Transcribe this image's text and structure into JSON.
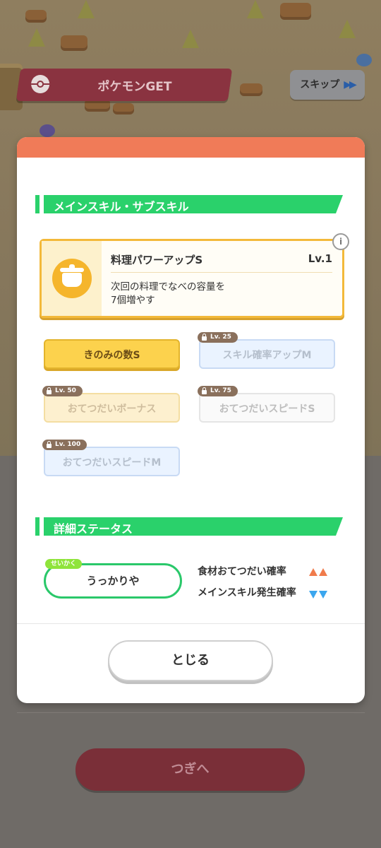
{
  "header": {
    "banner_label": "ポケモンGET",
    "skip_label": "スキップ",
    "skip_arrows": "▶▶"
  },
  "modal": {
    "section1_title": "メインスキル・サブスキル",
    "main_skill": {
      "name": "料理パワーアップS",
      "level": "Lv.1",
      "desc_line1": "次回の料理でなべの容量を",
      "desc_line2": "7個増やす",
      "info_label": "i"
    },
    "sub_skills": [
      {
        "label": "きのみの数S",
        "lock": ""
      },
      {
        "label": "スキル確率アップM",
        "lock": "Lv. 25"
      },
      {
        "label": "おてつだいボーナス",
        "lock": "Lv. 50"
      },
      {
        "label": "おてつだいスピードS",
        "lock": "Lv. 75"
      },
      {
        "label": "おてつだいスピードM",
        "lock": "Lv. 100"
      }
    ],
    "section2_title": "詳細ステータス",
    "nature": {
      "tag": "せいかく",
      "value": "うっかりや"
    },
    "stats": [
      {
        "label": "食材おてつだい確率",
        "direction": "up"
      },
      {
        "label": "メインスキル発生確率",
        "direction": "down"
      }
    ],
    "close_label": "とじる"
  },
  "footer": {
    "next_label": "つぎへ"
  },
  "colors": {
    "accent_green": "#2ad16b",
    "modal_header": "#f07b58",
    "gold": "#fcd24d",
    "up": "#f07b4b",
    "down": "#3ba6ee"
  }
}
